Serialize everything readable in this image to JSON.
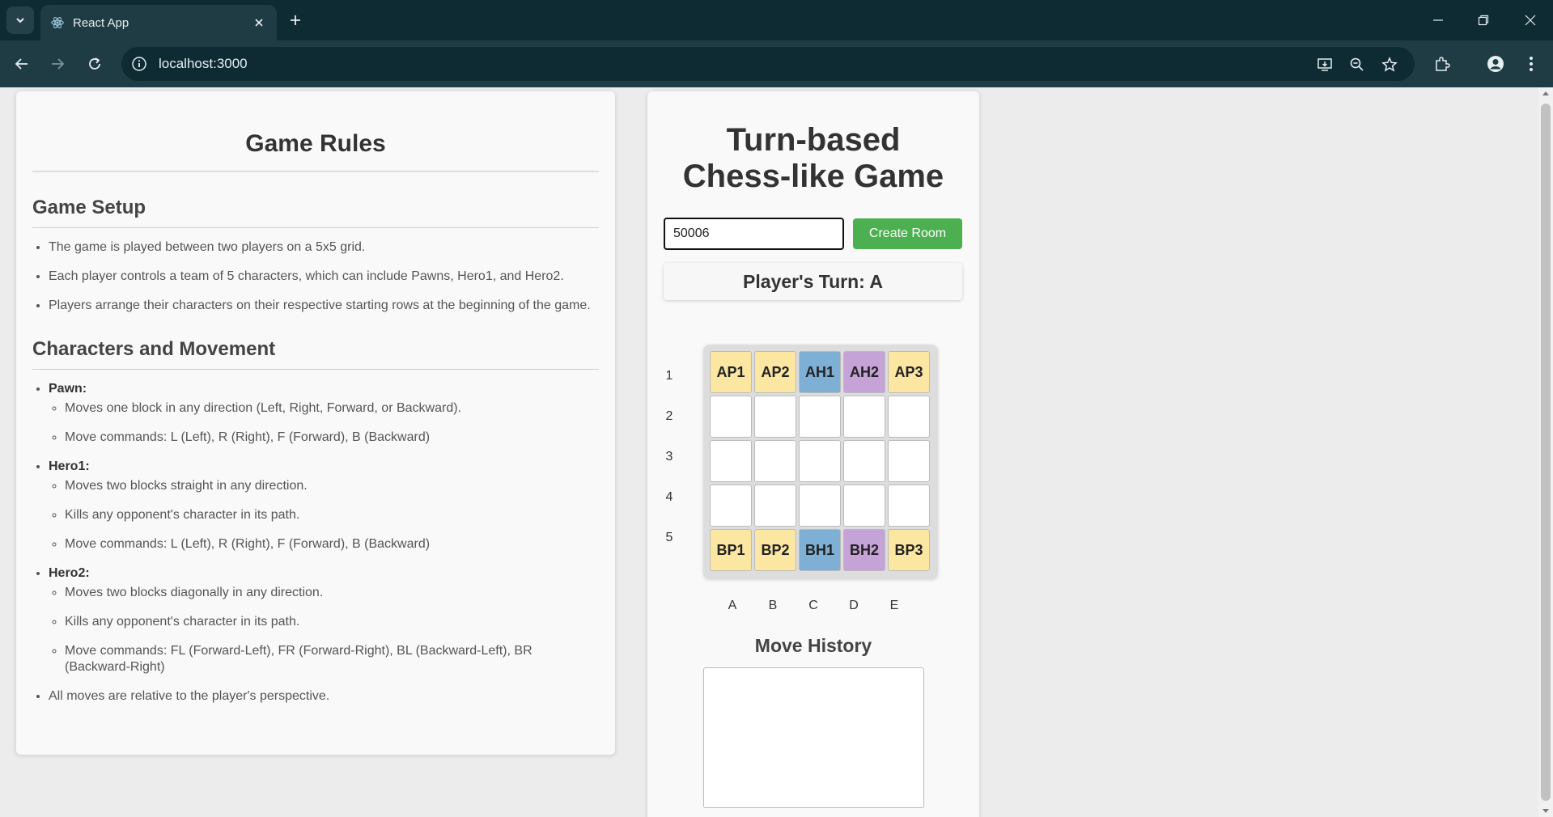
{
  "browser": {
    "tab_title": "React App",
    "url": "localhost:3000"
  },
  "rules": {
    "title": "Game Rules",
    "setup_heading": "Game Setup",
    "setup_items": [
      "The game is played between two players on a 5x5 grid.",
      "Each player controls a team of 5 characters, which can include Pawns, Hero1, and Hero2.",
      "Players arrange their characters on their respective starting rows at the beginning of the game."
    ],
    "movement_heading": "Characters and Movement",
    "pawn": {
      "name": "Pawn:",
      "items": [
        "Moves one block in any direction (Left, Right, Forward, or Backward).",
        "Move commands: L (Left), R (Right), F (Forward), B (Backward)"
      ]
    },
    "hero1": {
      "name": "Hero1:",
      "items": [
        "Moves two blocks straight in any direction.",
        "Kills any opponent's character in its path.",
        "Move commands: L (Left), R (Right), F (Forward), B (Backward)"
      ]
    },
    "hero2": {
      "name": "Hero2:",
      "items": [
        "Moves two blocks diagonally in any direction.",
        "Kills any opponent's character in its path.",
        "Move commands: FL (Forward-Left), FR (Forward-Right), BL (Backward-Left), BR (Backward-Right)"
      ]
    },
    "final_note": "All moves are relative to the player's perspective."
  },
  "game": {
    "title_line1": "Turn-based",
    "title_line2": "Chess-like Game",
    "room_input_value": "50006",
    "create_room_label": "Create Room",
    "turn_text": "Player's Turn: A",
    "row_labels": [
      "1",
      "2",
      "3",
      "4",
      "5"
    ],
    "col_labels": [
      "A",
      "B",
      "C",
      "D",
      "E"
    ],
    "board": [
      [
        "AP1",
        "AP2",
        "AH1",
        "AH2",
        "AP3"
      ],
      [
        "",
        "",
        "",
        "",
        ""
      ],
      [
        "",
        "",
        "",
        "",
        ""
      ],
      [
        "",
        "",
        "",
        "",
        ""
      ],
      [
        "BP1",
        "BP2",
        "BH1",
        "BH2",
        "BP3"
      ]
    ],
    "piece_colors": {
      "pawn": "#fbe6a2",
      "hero1": "#7eb0d5",
      "hero2": "#c5a3d6"
    },
    "history_title": "Move History",
    "history": []
  }
}
